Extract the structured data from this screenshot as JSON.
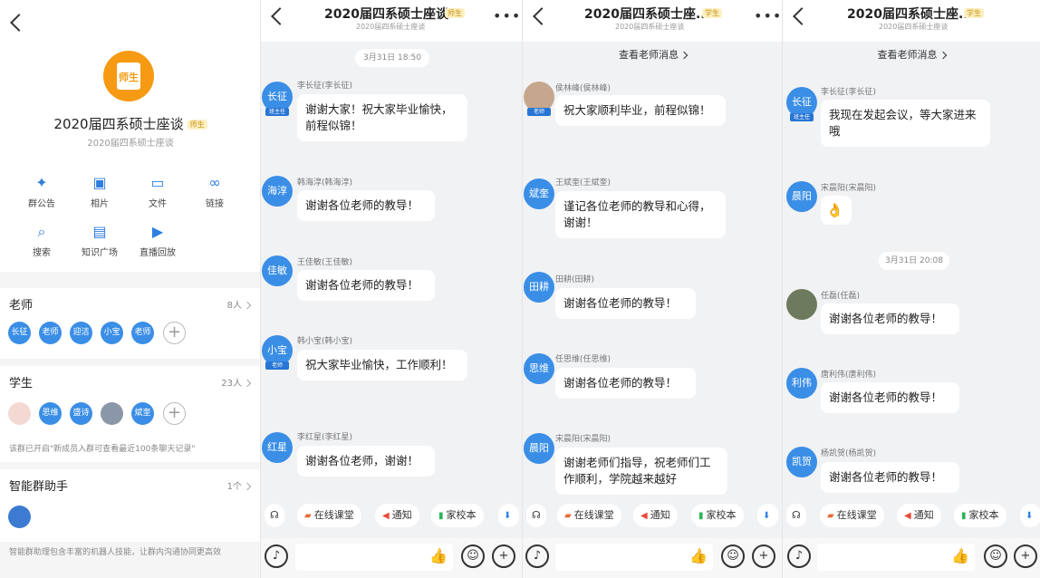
{
  "p1": {
    "group_name": "2020届四系硕士座谈",
    "badge": "师生",
    "avatar_text": "师生",
    "sub": "2020届四系硕士座谈",
    "functions": [
      {
        "label": "群公告",
        "icon": "megaphone-icon",
        "glyph": "✦"
      },
      {
        "label": "相片",
        "icon": "image-icon",
        "glyph": "▣"
      },
      {
        "label": "文件",
        "icon": "folder-icon",
        "glyph": "▭"
      },
      {
        "label": "链接",
        "icon": "link-icon",
        "glyph": "∞"
      },
      {
        "label": "搜索",
        "icon": "search-icon",
        "glyph": "⌕"
      },
      {
        "label": "知识广场",
        "icon": "book-icon",
        "glyph": "▤"
      },
      {
        "label": "直播回放",
        "icon": "tv-icon",
        "glyph": "▶"
      }
    ],
    "teachers": {
      "title": "老师",
      "count": "8人",
      "members": [
        "长征",
        "老师",
        "迎洁",
        "小宝",
        "老师"
      ]
    },
    "students": {
      "title": "学生",
      "count": "23人",
      "members": [
        "思维",
        "盛诗",
        "斌奎"
      ],
      "tip": "该群已开启\"新成员入群可查看最近100条聊天记录\""
    },
    "assistant": {
      "title": "智能群助手",
      "count": "1个",
      "tip": "智能群助理包含丰富的机器人技能，让群内沟通协同更高效"
    }
  },
  "chat": {
    "title": "2020届四系硕士座...",
    "full_title": "2020届四系硕士座谈",
    "badge_teacher": "师生",
    "badge_student": "学生",
    "sub": "2020届四系硕士座谈",
    "view_teacher_msgs": "查看老师消息",
    "tools": [
      {
        "label": "在线课堂",
        "icon": "classroom-icon"
      },
      {
        "label": "通知",
        "icon": "notice-icon"
      },
      {
        "label": "家校本",
        "icon": "homework-icon"
      }
    ]
  },
  "c1": {
    "time": "3月31日 18:50",
    "msgs": [
      {
        "av": "长征",
        "tag": "班主任",
        "name": "李长征(李长征)",
        "text": "谢谢大家！祝大家毕业愉快，前程似锦！"
      },
      {
        "av": "海淳",
        "name": "韩海淳(韩海淳)",
        "text": "谢谢各位老师的教导！"
      },
      {
        "av": "佳敏",
        "name": "王佳敏(王佳敏)",
        "text": "谢谢各位老师的教导！"
      },
      {
        "av": "小宝",
        "tag": "老师",
        "name": "韩小宝(韩小宝)",
        "text": "祝大家毕业愉快，工作顺利！"
      },
      {
        "av": "红星",
        "name": "李红星(李红星)",
        "text": "谢谢各位老师，谢谢！"
      }
    ]
  },
  "c2": {
    "msgs": [
      {
        "av": "",
        "tag": "老师",
        "name": "侯林峰(侯林峰)",
        "text": "祝大家顺利毕业，前程似锦！"
      },
      {
        "av": "斌奎",
        "name": "王斌奎(王斌奎)",
        "text": "谨记各位老师的教导和心得，谢谢！"
      },
      {
        "av": "田耕",
        "name": "田耕(田耕)",
        "text": "谢谢各位老师的教导！"
      },
      {
        "av": "思维",
        "name": "任思维(任思维)",
        "text": "谢谢各位老师的教导！"
      },
      {
        "av": "晨阳",
        "name": "宋晨阳(宋晨阳)",
        "text": "谢谢老师们指导，祝老师们工作顺利，学院越来越好"
      }
    ]
  },
  "c3": {
    "time": "3月31日 20:08",
    "msgs": [
      {
        "av": "长征",
        "tag": "班主任",
        "name": "李长征(李长征)",
        "text": "我现在发起会议，等大家进来哦"
      },
      {
        "av": "晨阳",
        "name": "宋晨阳(宋晨阳)",
        "text": "👌"
      },
      {
        "av": "",
        "name": "任磊(任磊)",
        "text": "谢谢各位老师的教导！"
      },
      {
        "av": "利伟",
        "name": "唐利伟(唐利伟)",
        "text": "谢谢各位老师的教导！"
      },
      {
        "av": "凯贺",
        "name": "杨凯贺(杨凯贺)",
        "text": "谢谢各位老师的教导！"
      }
    ]
  }
}
